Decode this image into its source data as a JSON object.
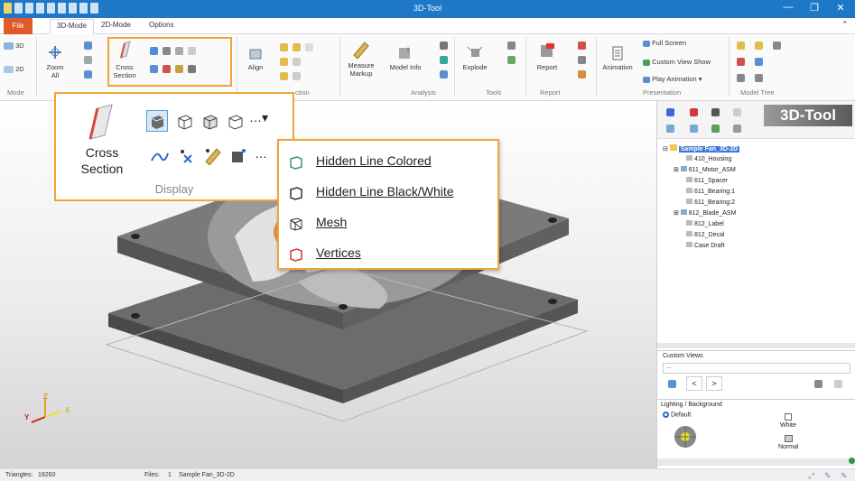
{
  "window": {
    "title": "3D-Tool",
    "minimize": "—",
    "restore": "❐",
    "close": "✕"
  },
  "tabs": {
    "file": "File",
    "mode3d": "3D-Mode",
    "mode2d": "2D-Mode",
    "options": "Options"
  },
  "ribbon": {
    "mode": {
      "btn3d": "3D",
      "btn2d": "2D",
      "group": "Mode"
    },
    "zoom_all": "Zoom All",
    "cross_section": "Cross Section",
    "align": "Align",
    "measure_markup": "Measure Markup",
    "model_info": "Model Info",
    "explode": "Explode",
    "report": "Report",
    "animation": "Animation",
    "full_screen": "Full Screen",
    "custom_view_show": "Custom View Show",
    "play_animation": "Play Animation",
    "groups": {
      "display": "ction",
      "analysis": "Analysis",
      "tools": "Tools",
      "report": "Report",
      "presentation": "Presentation",
      "model_tree": "Model Tree"
    }
  },
  "zoom_panel": {
    "cross_section_line1": "Cross",
    "cross_section_line2": "Section",
    "group_label": "Display"
  },
  "display_menu": {
    "items": [
      {
        "label": "Hidden Line Colored"
      },
      {
        "label": "Hidden Line Black/White"
      },
      {
        "label": "Mesh"
      },
      {
        "label": "Vertices"
      }
    ]
  },
  "axes": {
    "z": "Z",
    "y": "Y",
    "x": "X"
  },
  "right_panel": {
    "logo": "3D-Tool",
    "tree": [
      {
        "label": "Sample Fan_3D-2D",
        "selected": true
      },
      {
        "label": "410_Housing"
      },
      {
        "label": "611_Motor_ASM"
      },
      {
        "label": "611_Spacer"
      },
      {
        "label": "611_Bearing:1"
      },
      {
        "label": "611_Bearing:2"
      },
      {
        "label": "812_Blade_ASM"
      },
      {
        "label": "812_Label"
      },
      {
        "label": "812_Decal"
      },
      {
        "label": "Case Draft"
      }
    ],
    "custom_views": {
      "title": "Custom Views",
      "value": "...",
      "prev": "<",
      "next": ">"
    },
    "lighting": {
      "title": "Lighting / Background",
      "default": "Default",
      "white": "White",
      "normal": "Normal"
    }
  },
  "status": {
    "triangles_label": "Triangles:",
    "triangles": "19260",
    "files_label": "Files:",
    "files": "1",
    "filename": "Sample Fan_3D-2D"
  },
  "colors": {
    "title_blue": "#1e78c8",
    "file_orange": "#e05a2a",
    "highlight_orange": "#f2a33a",
    "tree_selected": "#3a78d8"
  }
}
